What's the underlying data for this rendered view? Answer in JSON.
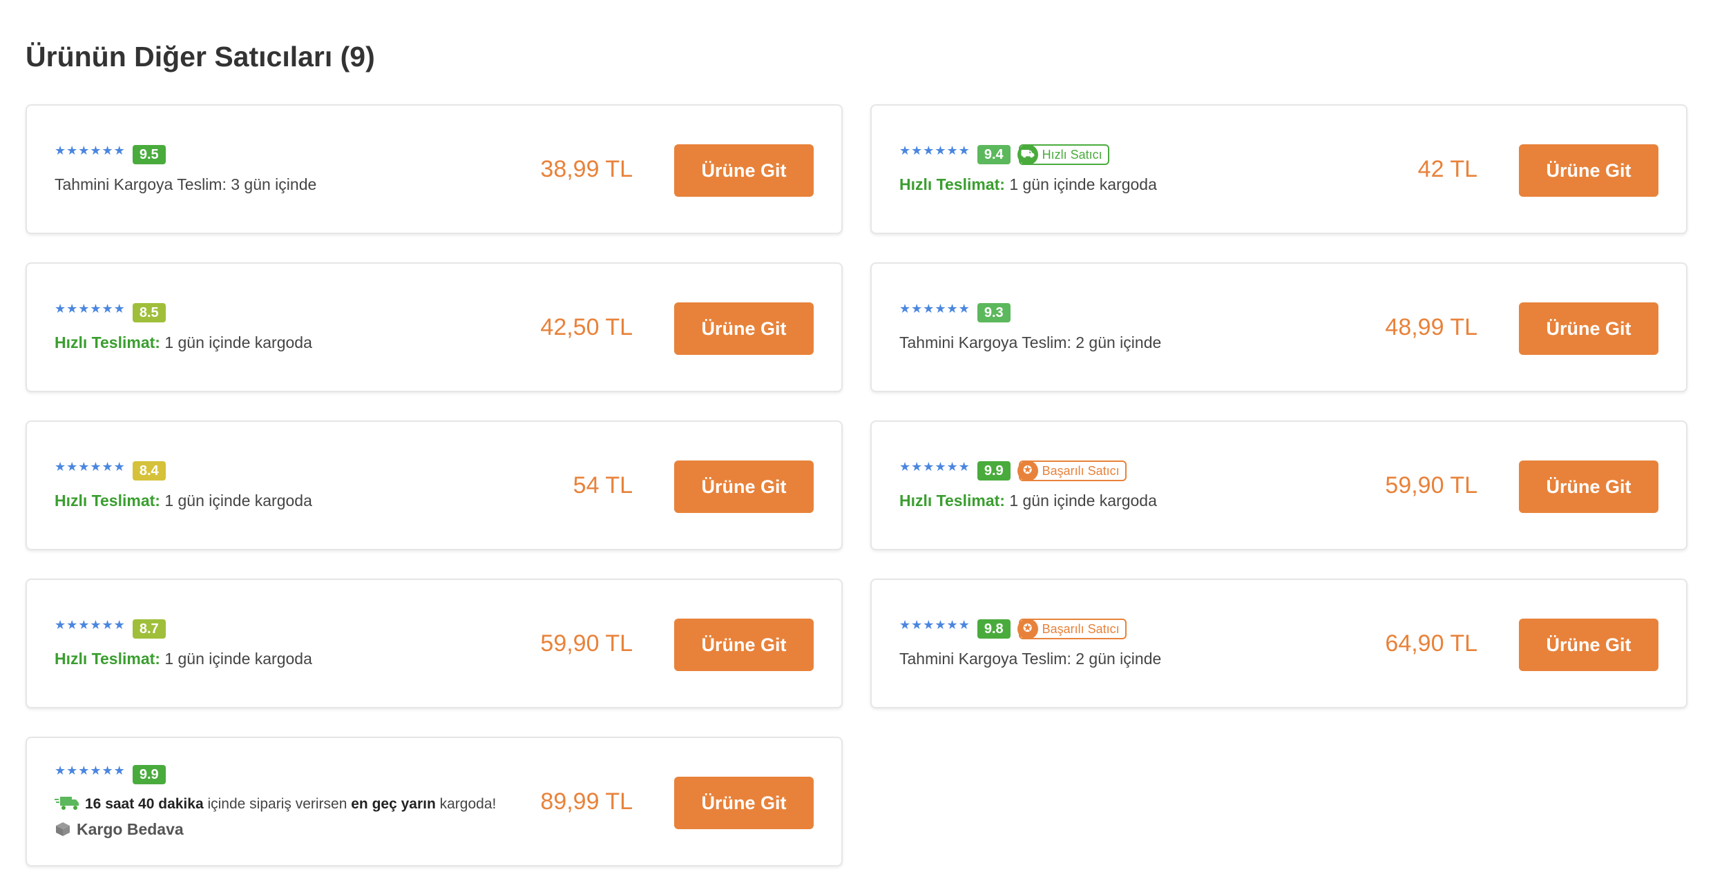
{
  "header": {
    "title": "Ürünün Diğer Satıcıları (9)"
  },
  "colors": {
    "accent_orange": "#e8823a",
    "fast_green": "#3a9e2f",
    "star_blue": "#4a86e0",
    "score_high": "#4aab3d",
    "score_mid": "#9fbf3a",
    "score_low": "#d6c23a"
  },
  "sellers": [
    {
      "stars": "★★★★★★",
      "score": "9.5",
      "score_color": "#4aab3d",
      "badge": null,
      "delivery_type": "estimate",
      "delivery_label": "",
      "delivery_text": "Tahmini Kargoya Teslim: 3 gün içinde",
      "price": "38,99 TL",
      "button_label": "Ürüne Git"
    },
    {
      "stars": "★★★★★★",
      "score": "9.4",
      "score_color": "#5cb85c",
      "badge": {
        "type": "fast",
        "label": "Hızlı Satıcı",
        "icon": "truck-icon"
      },
      "delivery_type": "fast",
      "delivery_label": "Hızlı Teslimat:",
      "delivery_text": " 1 gün içinde kargoda",
      "price": "42 TL",
      "button_label": "Ürüne Git"
    },
    {
      "stars": "★★★★★★",
      "score": "8.5",
      "score_color": "#9fbf3a",
      "badge": null,
      "delivery_type": "fast",
      "delivery_label": "Hızlı Teslimat:",
      "delivery_text": " 1 gün içinde kargoda",
      "price": "42,50 TL",
      "button_label": "Ürüne Git"
    },
    {
      "stars": "★★★★★★",
      "score": "9.3",
      "score_color": "#5cb85c",
      "badge": null,
      "delivery_type": "estimate",
      "delivery_label": "",
      "delivery_text": "Tahmini Kargoya Teslim: 2 gün içinde",
      "price": "48,99 TL",
      "button_label": "Ürüne Git"
    },
    {
      "stars": "★★★★★★",
      "score": "8.4",
      "score_color": "#d6c23a",
      "badge": null,
      "delivery_type": "fast",
      "delivery_label": "Hızlı Teslimat:",
      "delivery_text": " 1 gün içinde kargoda",
      "price": "54 TL",
      "button_label": "Ürüne Git"
    },
    {
      "stars": "★★★★★★",
      "score": "9.9",
      "score_color": "#4aab3d",
      "badge": {
        "type": "success",
        "label": "Başarılı Satıcı",
        "icon": "medal-icon"
      },
      "delivery_type": "fast",
      "delivery_label": "Hızlı Teslimat:",
      "delivery_text": " 1 gün içinde kargoda",
      "price": "59,90 TL",
      "button_label": "Ürüne Git"
    },
    {
      "stars": "★★★★★★",
      "score": "8.7",
      "score_color": "#9fbf3a",
      "badge": null,
      "delivery_type": "fast",
      "delivery_label": "Hızlı Teslimat:",
      "delivery_text": " 1 gün içinde kargoda",
      "price": "59,90 TL",
      "button_label": "Ürüne Git"
    },
    {
      "stars": "★★★★★★",
      "score": "9.8",
      "score_color": "#4aab3d",
      "badge": {
        "type": "success",
        "label": "Başarılı Satıcı",
        "icon": "medal-icon"
      },
      "delivery_type": "estimate",
      "delivery_label": "",
      "delivery_text": "Tahmini Kargoya Teslim: 2 gün içinde",
      "price": "64,90 TL",
      "button_label": "Ürüne Git"
    },
    {
      "stars": "★★★★★★",
      "score": "9.9",
      "score_color": "#4aab3d",
      "badge": null,
      "delivery_type": "countdown",
      "countdown": {
        "time": "16 saat 40 dakika",
        "middle": " içinde sipariş verirsen ",
        "emphasis": "en geç yarın",
        "end": " kargoda!"
      },
      "free_cargo": "Kargo Bedava",
      "price": "89,99 TL",
      "button_label": "Ürüne Git"
    }
  ]
}
